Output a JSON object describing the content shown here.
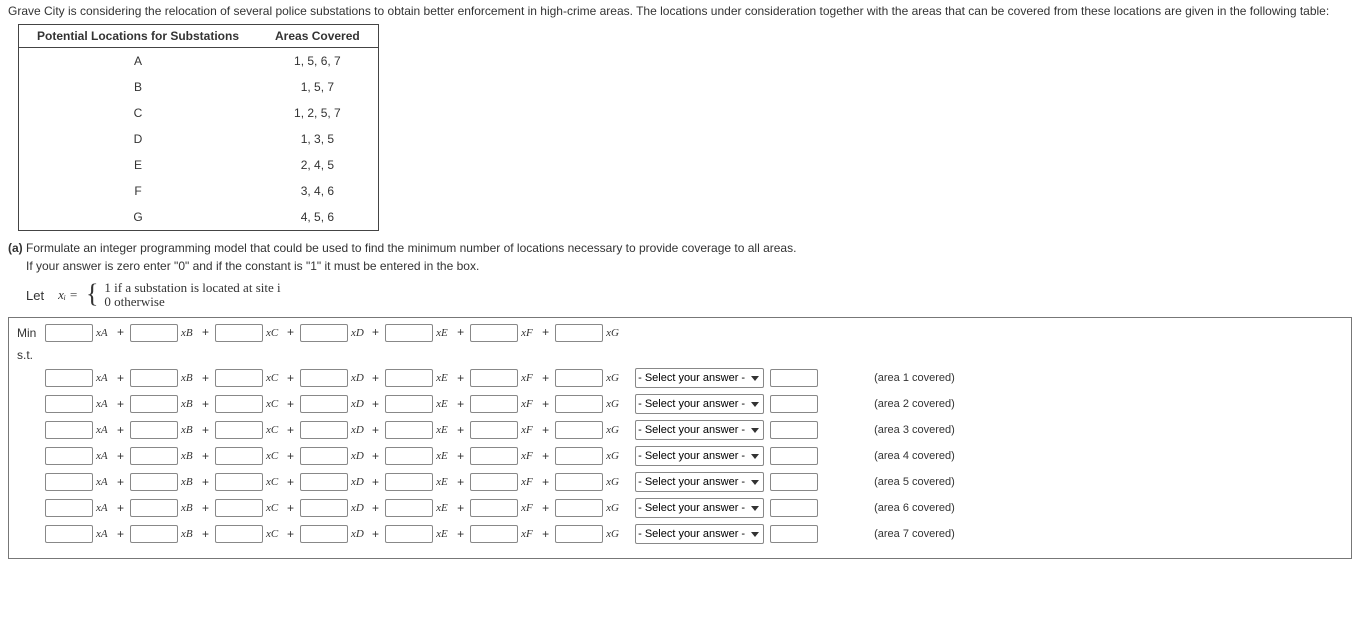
{
  "intro": "Grave City is considering the relocation of several police substations to obtain better enforcement in high-crime areas. The locations under consideration together with the areas that can be covered from these locations are given in the following table:",
  "table": {
    "header1": "Potential Locations for Substations",
    "header2": "Areas Covered",
    "rows": [
      {
        "loc": "A",
        "areas": "1, 5, 6, 7"
      },
      {
        "loc": "B",
        "areas": "1, 5, 7"
      },
      {
        "loc": "C",
        "areas": "1, 2, 5, 7"
      },
      {
        "loc": "D",
        "areas": "1, 3, 5"
      },
      {
        "loc": "E",
        "areas": "2, 4, 5"
      },
      {
        "loc": "F",
        "areas": "3, 4, 6"
      },
      {
        "loc": "G",
        "areas": "4, 5, 6"
      }
    ]
  },
  "partA": {
    "label": "(a)",
    "text": "Formulate an integer programming model that could be used to find the minimum number of locations necessary to provide coverage to all areas."
  },
  "note": "If your answer is zero enter \"0\" and if the constant is \"1\" it must be entered in the box.",
  "definition": {
    "let": "Let",
    "xi": "xᵢ =",
    "case1": "1 if a substation is located at site i",
    "case2": "0 otherwise"
  },
  "vars": [
    "xA",
    "xB",
    "xC",
    "xD",
    "xE",
    "xF",
    "xG"
  ],
  "min": "Min",
  "st": "s.t.",
  "selectPlaceholder": "- Select your answer -",
  "areas": [
    "(area 1 covered)",
    "(area 2 covered)",
    "(area 3 covered)",
    "(area 4 covered)",
    "(area 5 covered)",
    "(area 6 covered)",
    "(area 7 covered)"
  ],
  "plus": "+"
}
